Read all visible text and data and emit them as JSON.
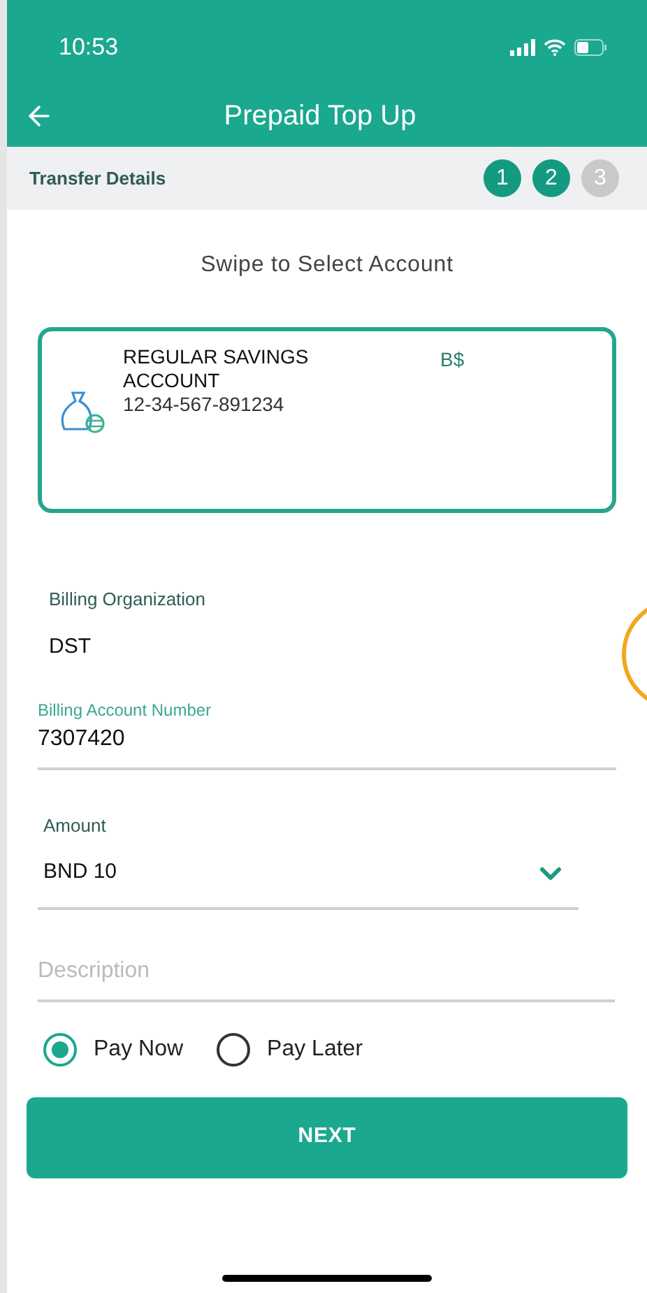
{
  "status_bar": {
    "time": "10:53"
  },
  "header": {
    "title": "Prepaid Top Up"
  },
  "steps_bar": {
    "label": "Transfer Details",
    "steps": [
      {
        "label": "1",
        "active": true
      },
      {
        "label": "2",
        "active": true
      },
      {
        "label": "3",
        "active": false
      }
    ]
  },
  "account_picker": {
    "prompt": "Swipe to Select Account",
    "account": {
      "name": "REGULAR SAVINGS ACCOUNT",
      "number": "12-34-567-891234",
      "currency": "B$"
    }
  },
  "fields": [
    {
      "kind": "static",
      "label": "Billing Organization",
      "value": "DST"
    },
    {
      "kind": "input",
      "label": "Billing Account Number",
      "value": "7307420"
    },
    {
      "kind": "select",
      "label": "Amount",
      "value": "BND 10"
    },
    {
      "kind": "input",
      "placeholder": "Description"
    }
  ],
  "payment_options": [
    {
      "label": "Pay Now",
      "selected": true
    },
    {
      "label": "Pay Later",
      "selected": false
    }
  ],
  "next_button": "NEXT"
}
